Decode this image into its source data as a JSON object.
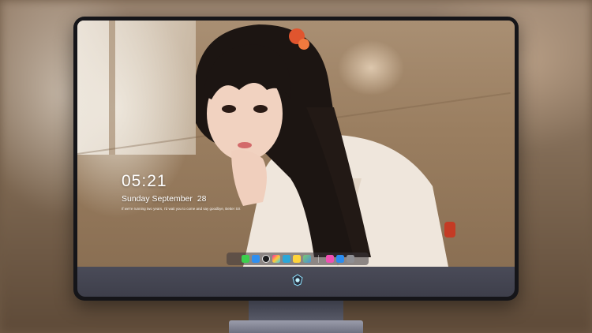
{
  "lockscreen": {
    "time": "05:21",
    "date": "Sunday September  28",
    "quote": "If we're running two years, I'd wait you to come and say goodbye, Better SX"
  },
  "dock": {
    "apps": [
      {
        "name": "messages-icon",
        "color": "#3ccf4e"
      },
      {
        "name": "weather-icon",
        "color": "#2f8ff0"
      },
      {
        "name": "clock-icon",
        "color": "#e8e8e8"
      },
      {
        "name": "photos-icon",
        "color": "#d9d9d9"
      },
      {
        "name": "video-icon",
        "color": "#2ba7d8"
      },
      {
        "name": "notes-icon",
        "color": "#ffd43b"
      },
      {
        "name": "maps-icon",
        "color": "#5aa85a"
      },
      {
        "name": "music-icon",
        "color": "#f04fb3"
      },
      {
        "name": "appstore-icon",
        "color": "#2b8cf0"
      },
      {
        "name": "camera-icon",
        "color": "#8e8e93"
      }
    ]
  }
}
